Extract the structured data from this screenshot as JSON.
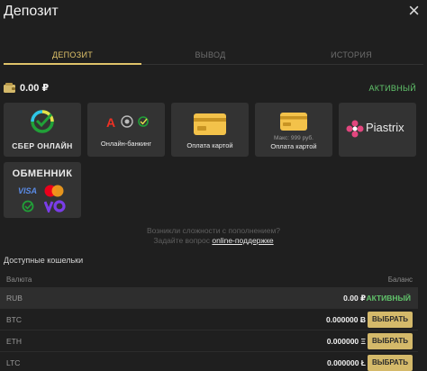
{
  "header": {
    "title": "Депозит",
    "close_label": "×"
  },
  "tabs": [
    {
      "label": "ДЕПОЗИТ",
      "active": true
    },
    {
      "label": "ВЫВОД",
      "active": false
    },
    {
      "label": "ИСТОРИЯ",
      "active": false
    }
  ],
  "balance": {
    "amount": "0.00 ₽",
    "status": "АКТИВНЫЙ"
  },
  "methods": {
    "sber": {
      "label": "СБЕР ОНЛАЙН"
    },
    "online_banking": {
      "label": "Онлайн-банкинг"
    },
    "card1": {
      "label": "Оплата картой"
    },
    "card2": {
      "label": "Оплата картой",
      "note": "Макс: 999 руб."
    },
    "piastrix": {
      "label": "Piastrix"
    },
    "exchanger": {
      "label": "ОБМЕННИК",
      "visa": "VISA"
    }
  },
  "help": {
    "line1": "Возникли сложности с пополнением?",
    "line2_prefix": "Задайте вопрос",
    "link": "online-поддержке"
  },
  "wallets": {
    "title": "Доступные кошельки",
    "col_currency": "Валюта",
    "col_balance": "Баланс",
    "rows": [
      {
        "currency": "RUB",
        "amount": "0.00 ₽",
        "status": "АКТИВНЫЙ"
      },
      {
        "currency": "BTC",
        "amount": "0.000000 Ƀ",
        "button": "ВЫБРАТЬ"
      },
      {
        "currency": "ETH",
        "amount": "0.000000 Ξ",
        "button": "ВЫБРАТЬ"
      },
      {
        "currency": "LTC",
        "amount": "0.000000 Ł",
        "button": "ВЫБРАТЬ"
      }
    ]
  },
  "colors": {
    "accent": "#e0c36a",
    "active": "#61c46b",
    "card": "#333333",
    "button": "#d4b96a"
  }
}
